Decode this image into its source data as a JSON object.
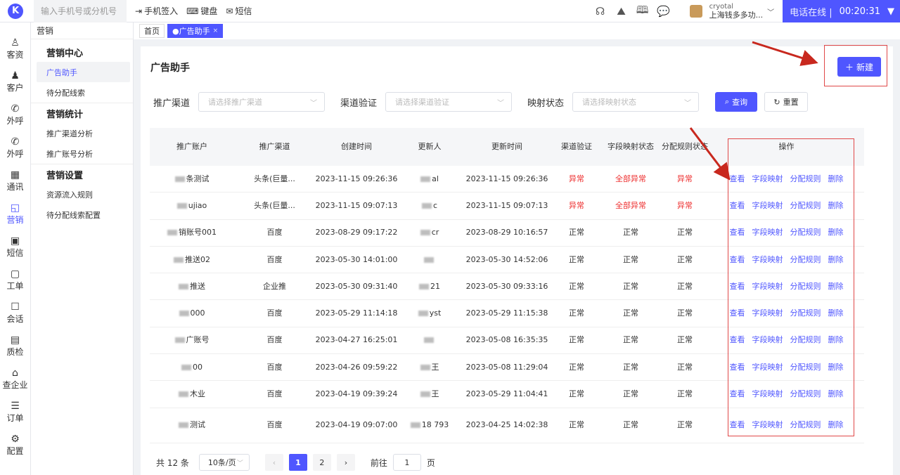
{
  "topbar": {
    "logo": "K",
    "phone_placeholder": "输入手机号或分机号",
    "actions": [
      "手机签入",
      "键盘",
      "短信"
    ],
    "user_line1": "cryotal",
    "user_line2": "上海钱多多功...",
    "status_text": "电话在线 |",
    "timer": "00:20:31",
    "colors": {
      "brand": "#4f56ff"
    }
  },
  "iconnav": {
    "items": [
      {
        "label": "客资",
        "icon": "user-icon"
      },
      {
        "label": "客户",
        "icon": "person-icon"
      },
      {
        "label": "外呼",
        "icon": "phone-out-icon"
      },
      {
        "label": "外呼",
        "icon": "phone-out-icon"
      },
      {
        "label": "通讯",
        "icon": "contacts-icon"
      },
      {
        "label": "营销",
        "icon": "marketing-icon"
      },
      {
        "label": "短信",
        "icon": "message-icon"
      },
      {
        "label": "工单",
        "icon": "clipboard-icon"
      },
      {
        "label": "会话",
        "icon": "chat-icon"
      },
      {
        "label": "质检",
        "icon": "check-calendar-icon"
      },
      {
        "label": "查企业",
        "icon": "building-icon"
      },
      {
        "label": "订单",
        "icon": "order-icon"
      },
      {
        "label": "配置",
        "icon": "gear-icon"
      }
    ]
  },
  "submenu": {
    "header": "营销",
    "group1": "营销中心",
    "g1_items": [
      "广告助手",
      "待分配线索"
    ],
    "group2": "营销统计",
    "g2_items": [
      "推广渠道分析",
      "推广账号分析"
    ],
    "group3": "营销设置",
    "g3_items": [
      "资源流入规则",
      "待分配线索配置"
    ]
  },
  "tabs": {
    "home": "首页",
    "active": "●广告助手",
    "close": "×"
  },
  "page": {
    "title": "广告助手",
    "new_button": "新建",
    "filters": [
      {
        "label": "推广渠道",
        "placeholder": "请选择推广渠道"
      },
      {
        "label": "渠道验证",
        "placeholder": "请选择渠道验证"
      },
      {
        "label": "映射状态",
        "placeholder": "请选择映射状态"
      }
    ],
    "query_button": "查询",
    "reset_button": "重置"
  },
  "table": {
    "headers": [
      "推广账户",
      "推广渠道",
      "创建时间",
      "更新人",
      "更新时间",
      "渠道验证",
      "字段映射状态",
      "分配规则状态",
      "操作"
    ],
    "ops": [
      "查看",
      "字段映射",
      "分配规则",
      "删除"
    ],
    "rows": [
      {
        "account": "条测试",
        "channel": "头条(巨量...",
        "created": "2023-11-15 09:26:36",
        "updater": "al",
        "updated": "2023-11-15 09:26:36",
        "verify": "异常",
        "field": "全部异常",
        "rule": "异常"
      },
      {
        "account": "ujiao",
        "channel": "头条(巨量...",
        "created": "2023-11-15 09:07:13",
        "updater": "c",
        "updated": "2023-11-15 09:07:13",
        "verify": "异常",
        "field": "全部异常",
        "rule": "异常"
      },
      {
        "account": "销账号001",
        "channel": "百度",
        "created": "2023-08-29 09:17:22",
        "updater": "cr",
        "updated": "2023-08-29 10:16:57",
        "verify": "正常",
        "field": "正常",
        "rule": "正常"
      },
      {
        "account": "推送02",
        "channel": "百度",
        "created": "2023-05-30 14:01:00",
        "updater": "",
        "updated": "2023-05-30 14:52:06",
        "verify": "正常",
        "field": "正常",
        "rule": "正常"
      },
      {
        "account": "推送",
        "channel": "企业推",
        "created": "2023-05-30 09:31:40",
        "updater": "21",
        "updated": "2023-05-30 09:33:16",
        "verify": "正常",
        "field": "正常",
        "rule": "正常"
      },
      {
        "account": "000",
        "channel": "百度",
        "created": "2023-05-29 11:14:18",
        "updater": "yst",
        "updated": "2023-05-29 11:15:38",
        "verify": "正常",
        "field": "正常",
        "rule": "正常"
      },
      {
        "account": "广账号",
        "channel": "百度",
        "created": "2023-04-27 16:25:01",
        "updater": "",
        "updated": "2023-05-08 16:35:35",
        "verify": "正常",
        "field": "正常",
        "rule": "正常"
      },
      {
        "account": "00",
        "channel": "百度",
        "created": "2023-04-26 09:59:22",
        "updater": "王",
        "updated": "2023-05-08 11:29:04",
        "verify": "正常",
        "field": "正常",
        "rule": "正常"
      },
      {
        "account": "木业",
        "channel": "百度",
        "created": "2023-04-19 09:39:24",
        "updater": "王",
        "updated": "2023-05-29 11:04:41",
        "verify": "正常",
        "field": "正常",
        "rule": "正常"
      },
      {
        "account": "测试",
        "channel": "百度",
        "created": "2023-04-19 09:07:00",
        "updater": "18 793",
        "updated": "2023-04-25 14:02:38",
        "verify": "正常",
        "field": "正常",
        "rule": "正常"
      }
    ]
  },
  "pagination": {
    "total": "共 12 条",
    "page_size": "10条/页",
    "pages": [
      "1",
      "2"
    ],
    "goto_label": "前往",
    "goto_value": "1",
    "page_unit": "页"
  }
}
